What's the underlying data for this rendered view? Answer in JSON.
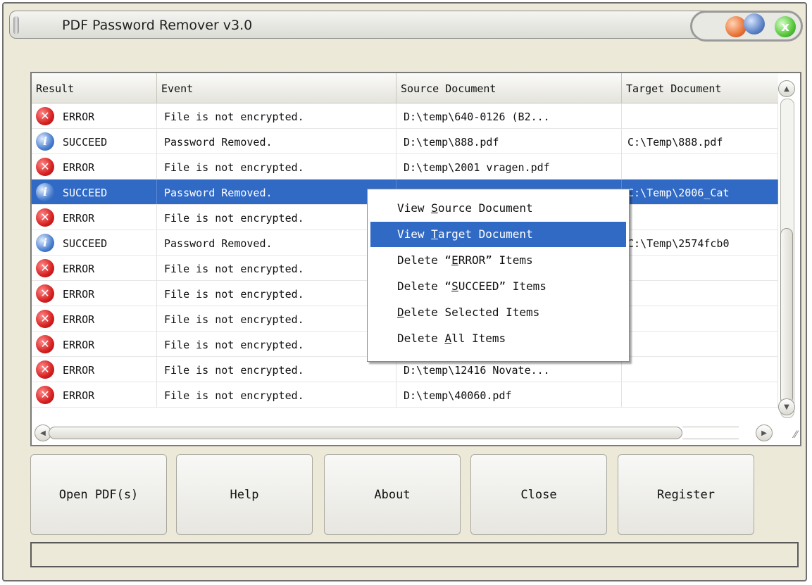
{
  "app": {
    "title": "PDF Password Remover v3.0",
    "close_symbol": "x"
  },
  "columns": [
    {
      "label": "Result"
    },
    {
      "label": "Event"
    },
    {
      "label": "Source Document"
    },
    {
      "label": "Target Document"
    }
  ],
  "rows": [
    {
      "result": "ERROR",
      "status": "error",
      "event": "File is not encrypted.",
      "source": "D:\\temp\\640-0126 (B2...",
      "target": ""
    },
    {
      "result": "SUCCEED",
      "status": "succeed",
      "event": "Password Removed.",
      "source": "D:\\temp\\888.pdf",
      "target": "C:\\Temp\\888.pdf"
    },
    {
      "result": "ERROR",
      "status": "error",
      "event": "File is not encrypted.",
      "source": "D:\\temp\\2001 vragen.pdf",
      "target": ""
    },
    {
      "result": "SUCCEED",
      "status": "succeed",
      "event": "Password Removed.",
      "source": "",
      "target": "C:\\Temp\\2006_Cat",
      "selected": true
    },
    {
      "result": "ERROR",
      "status": "error",
      "event": "File is not encrypted.",
      "source": "",
      "target": ""
    },
    {
      "result": "SUCCEED",
      "status": "succeed",
      "event": "Password Removed.",
      "source": "",
      "target": "C:\\Temp\\2574fcb0"
    },
    {
      "result": "ERROR",
      "status": "error",
      "event": "File is not encrypted.",
      "source": "",
      "target": ""
    },
    {
      "result": "ERROR",
      "status": "error",
      "event": "File is not encrypted.",
      "source": "",
      "target": ""
    },
    {
      "result": "ERROR",
      "status": "error",
      "event": "File is not encrypted.",
      "source": "",
      "target": ""
    },
    {
      "result": "ERROR",
      "status": "error",
      "event": "File is not encrypted.",
      "source": "",
      "target": ""
    },
    {
      "result": "ERROR",
      "status": "error",
      "event": "File is not encrypted.",
      "source": "D:\\temp\\12416 Novate...",
      "target": ""
    },
    {
      "result": "ERROR",
      "status": "error",
      "event": "File is not encrypted.",
      "source": "D:\\temp\\40060.pdf",
      "target": ""
    }
  ],
  "context_menu": {
    "items": [
      {
        "pre": "View ",
        "accel": "S",
        "post": "ource Document"
      },
      {
        "pre": "View ",
        "accel": "T",
        "post": "arget Document",
        "highlighted": true
      },
      {
        "pre": "Delete “",
        "accel": "E",
        "post": "RROR” Items"
      },
      {
        "pre": "Delete “",
        "accel": "S",
        "post": "UCCEED” Items"
      },
      {
        "pre": "",
        "accel": "D",
        "post": "elete Selected Items"
      },
      {
        "pre": "Delete ",
        "accel": "A",
        "post": "ll Items"
      }
    ]
  },
  "buttons": {
    "open": "Open PDF(s)",
    "help": "Help",
    "about": "About",
    "close": "Close",
    "register": "Register"
  },
  "icons": {
    "error": "i",
    "succeed": "i"
  },
  "colors": {
    "selection": "#316ac5",
    "window_bg": "#ece9d8"
  }
}
